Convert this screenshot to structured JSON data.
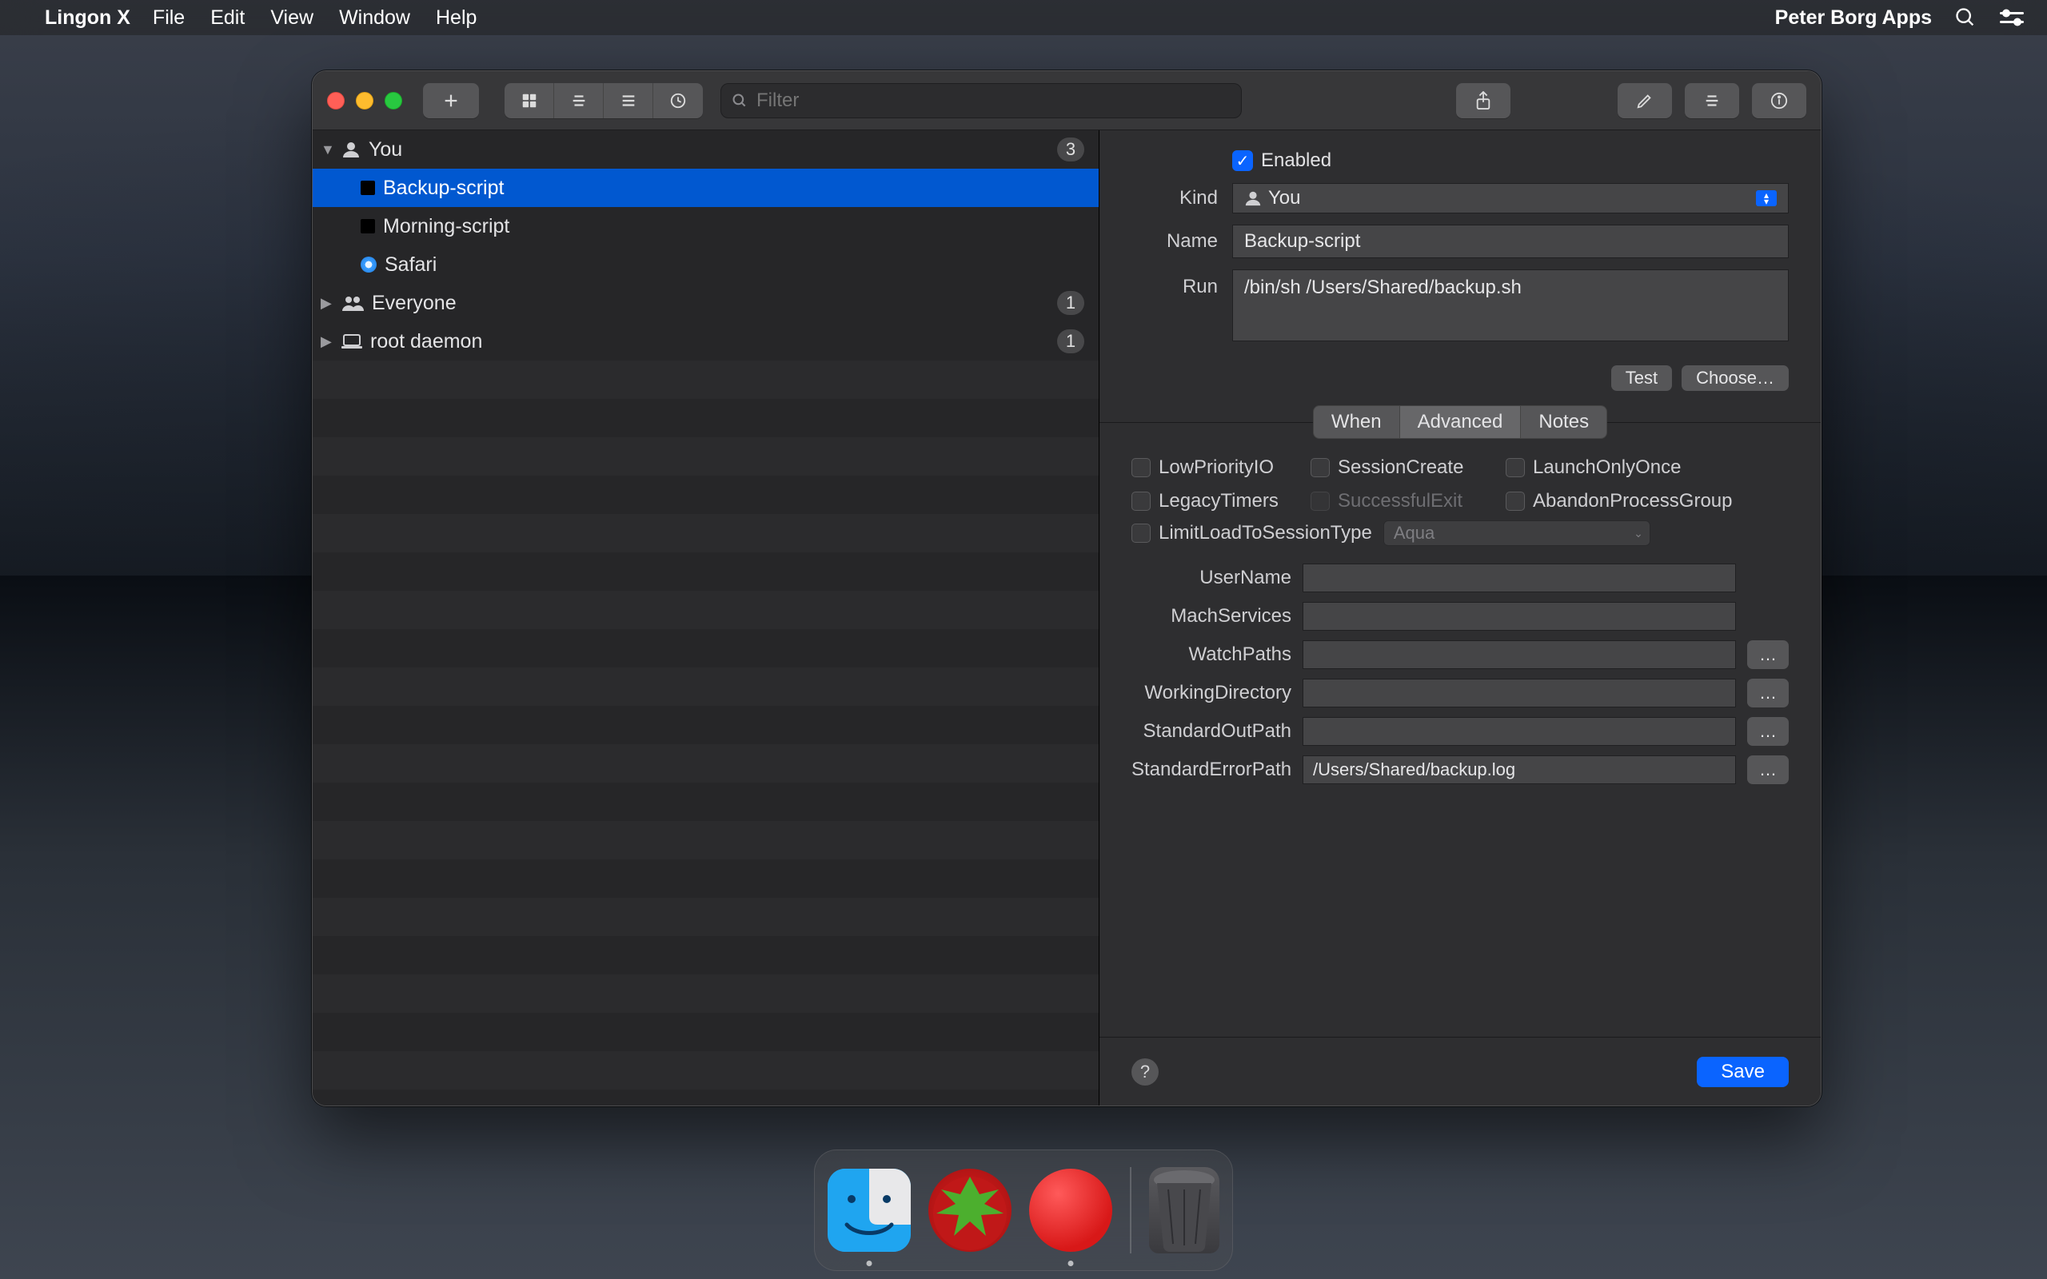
{
  "menubar": {
    "app": "Lingon X",
    "items": [
      "File",
      "Edit",
      "View",
      "Window",
      "Help"
    ],
    "right_title": "Peter Borg Apps"
  },
  "toolbar": {
    "search_placeholder": "Filter"
  },
  "sidebar": {
    "groups": [
      {
        "name": "You",
        "count": "3",
        "expanded": true,
        "icon": "person",
        "children": [
          {
            "label": "Backup-script",
            "icon": "terminal",
            "selected": true
          },
          {
            "label": "Morning-script",
            "icon": "terminal",
            "selected": false
          },
          {
            "label": "Safari",
            "icon": "safari",
            "selected": false
          }
        ]
      },
      {
        "name": "Everyone",
        "count": "1",
        "expanded": false,
        "icon": "people"
      },
      {
        "name": "root daemon",
        "count": "1",
        "expanded": false,
        "icon": "laptop"
      }
    ]
  },
  "detail": {
    "enabled_label": "Enabled",
    "enabled": true,
    "kind_label": "Kind",
    "kind_value": "You",
    "name_label": "Name",
    "name_value": "Backup-script",
    "run_label": "Run",
    "run_value": "/bin/sh /Users/Shared/backup.sh",
    "test_btn": "Test",
    "choose_btn": "Choose…",
    "tabs": [
      "When",
      "Advanced",
      "Notes"
    ],
    "active_tab": 1,
    "advanced": {
      "checks": [
        {
          "key": "LowPriorityIO",
          "checked": false,
          "disabled": false
        },
        {
          "key": "SessionCreate",
          "checked": false,
          "disabled": false
        },
        {
          "key": "LaunchOnlyOnce",
          "checked": false,
          "disabled": false
        },
        {
          "key": "LegacyTimers",
          "checked": false,
          "disabled": false
        },
        {
          "key": "SuccessfulExit",
          "checked": false,
          "disabled": true
        },
        {
          "key": "AbandonProcessGroup",
          "checked": false,
          "disabled": false
        }
      ],
      "limit_label": "LimitLoadToSessionType",
      "session_type": "Aqua",
      "fields": [
        {
          "label": "UserName",
          "value": "",
          "browse": false
        },
        {
          "label": "MachServices",
          "value": "",
          "browse": false
        },
        {
          "label": "WatchPaths",
          "value": "",
          "browse": true
        },
        {
          "label": "WorkingDirectory",
          "value": "",
          "browse": true
        },
        {
          "label": "StandardOutPath",
          "value": "",
          "browse": true
        },
        {
          "label": "StandardErrorPath",
          "value": "/Users/Shared/backup.log",
          "browse": true
        }
      ]
    },
    "save_btn": "Save"
  }
}
